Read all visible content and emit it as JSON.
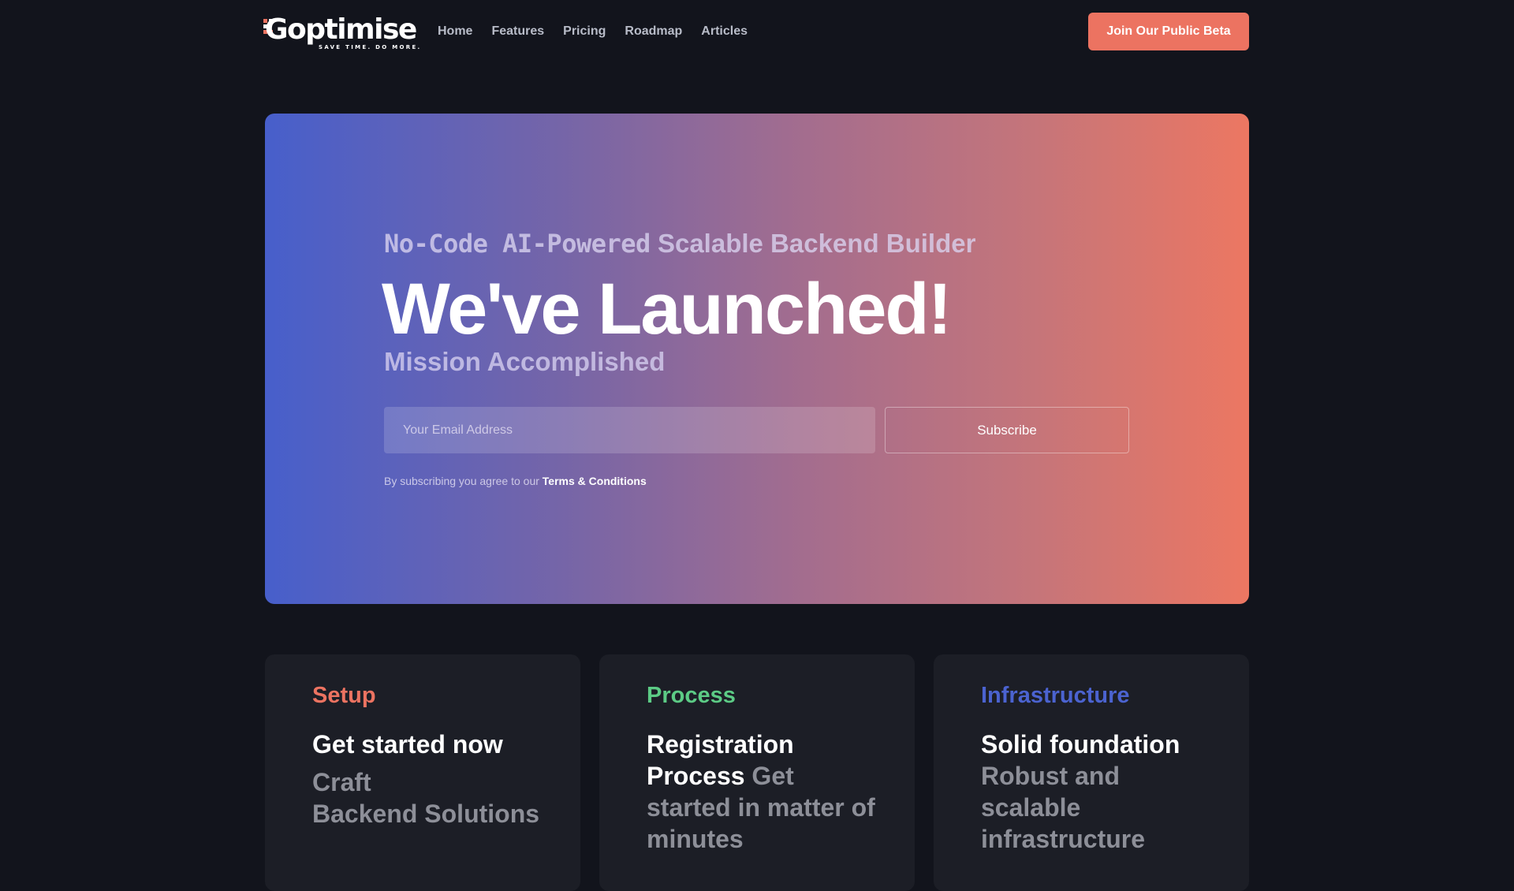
{
  "nav": {
    "logo_text": "Goptimise",
    "logo_tagline": "SAVE TIME. DO MORE.",
    "links": [
      "Home",
      "Features",
      "Pricing",
      "Roadmap",
      "Articles"
    ],
    "cta_label": "Join Our Public Beta"
  },
  "hero": {
    "subtitle_mono": "No-Code AI-Powered",
    "subtitle_rest": "Scalable Backend Builder",
    "title": "We've Launched!",
    "tagline": "Mission Accomplished",
    "email_placeholder": "Your Email Address",
    "email_value": "",
    "subscribe_label": "Subscribe",
    "terms_prefix": "By subscribing you agree to our",
    "terms_link": "Terms & Conditions"
  },
  "colors": {
    "accent_coral": "#ec7361",
    "setup": "#ec7361",
    "process": "#5ccb85",
    "infrastructure": "#4b63d0"
  },
  "cards": [
    {
      "label": "Setup",
      "head": "Get started now",
      "desc_line1": "Craft",
      "desc_line2": "Backend Solutions"
    },
    {
      "label": "Process",
      "head": "Registration Process",
      "desc": "Get started in matter of minutes"
    },
    {
      "label": "Infrastructure",
      "head": "Solid foundation",
      "desc": "Robust and scalable infrastructure"
    }
  ]
}
